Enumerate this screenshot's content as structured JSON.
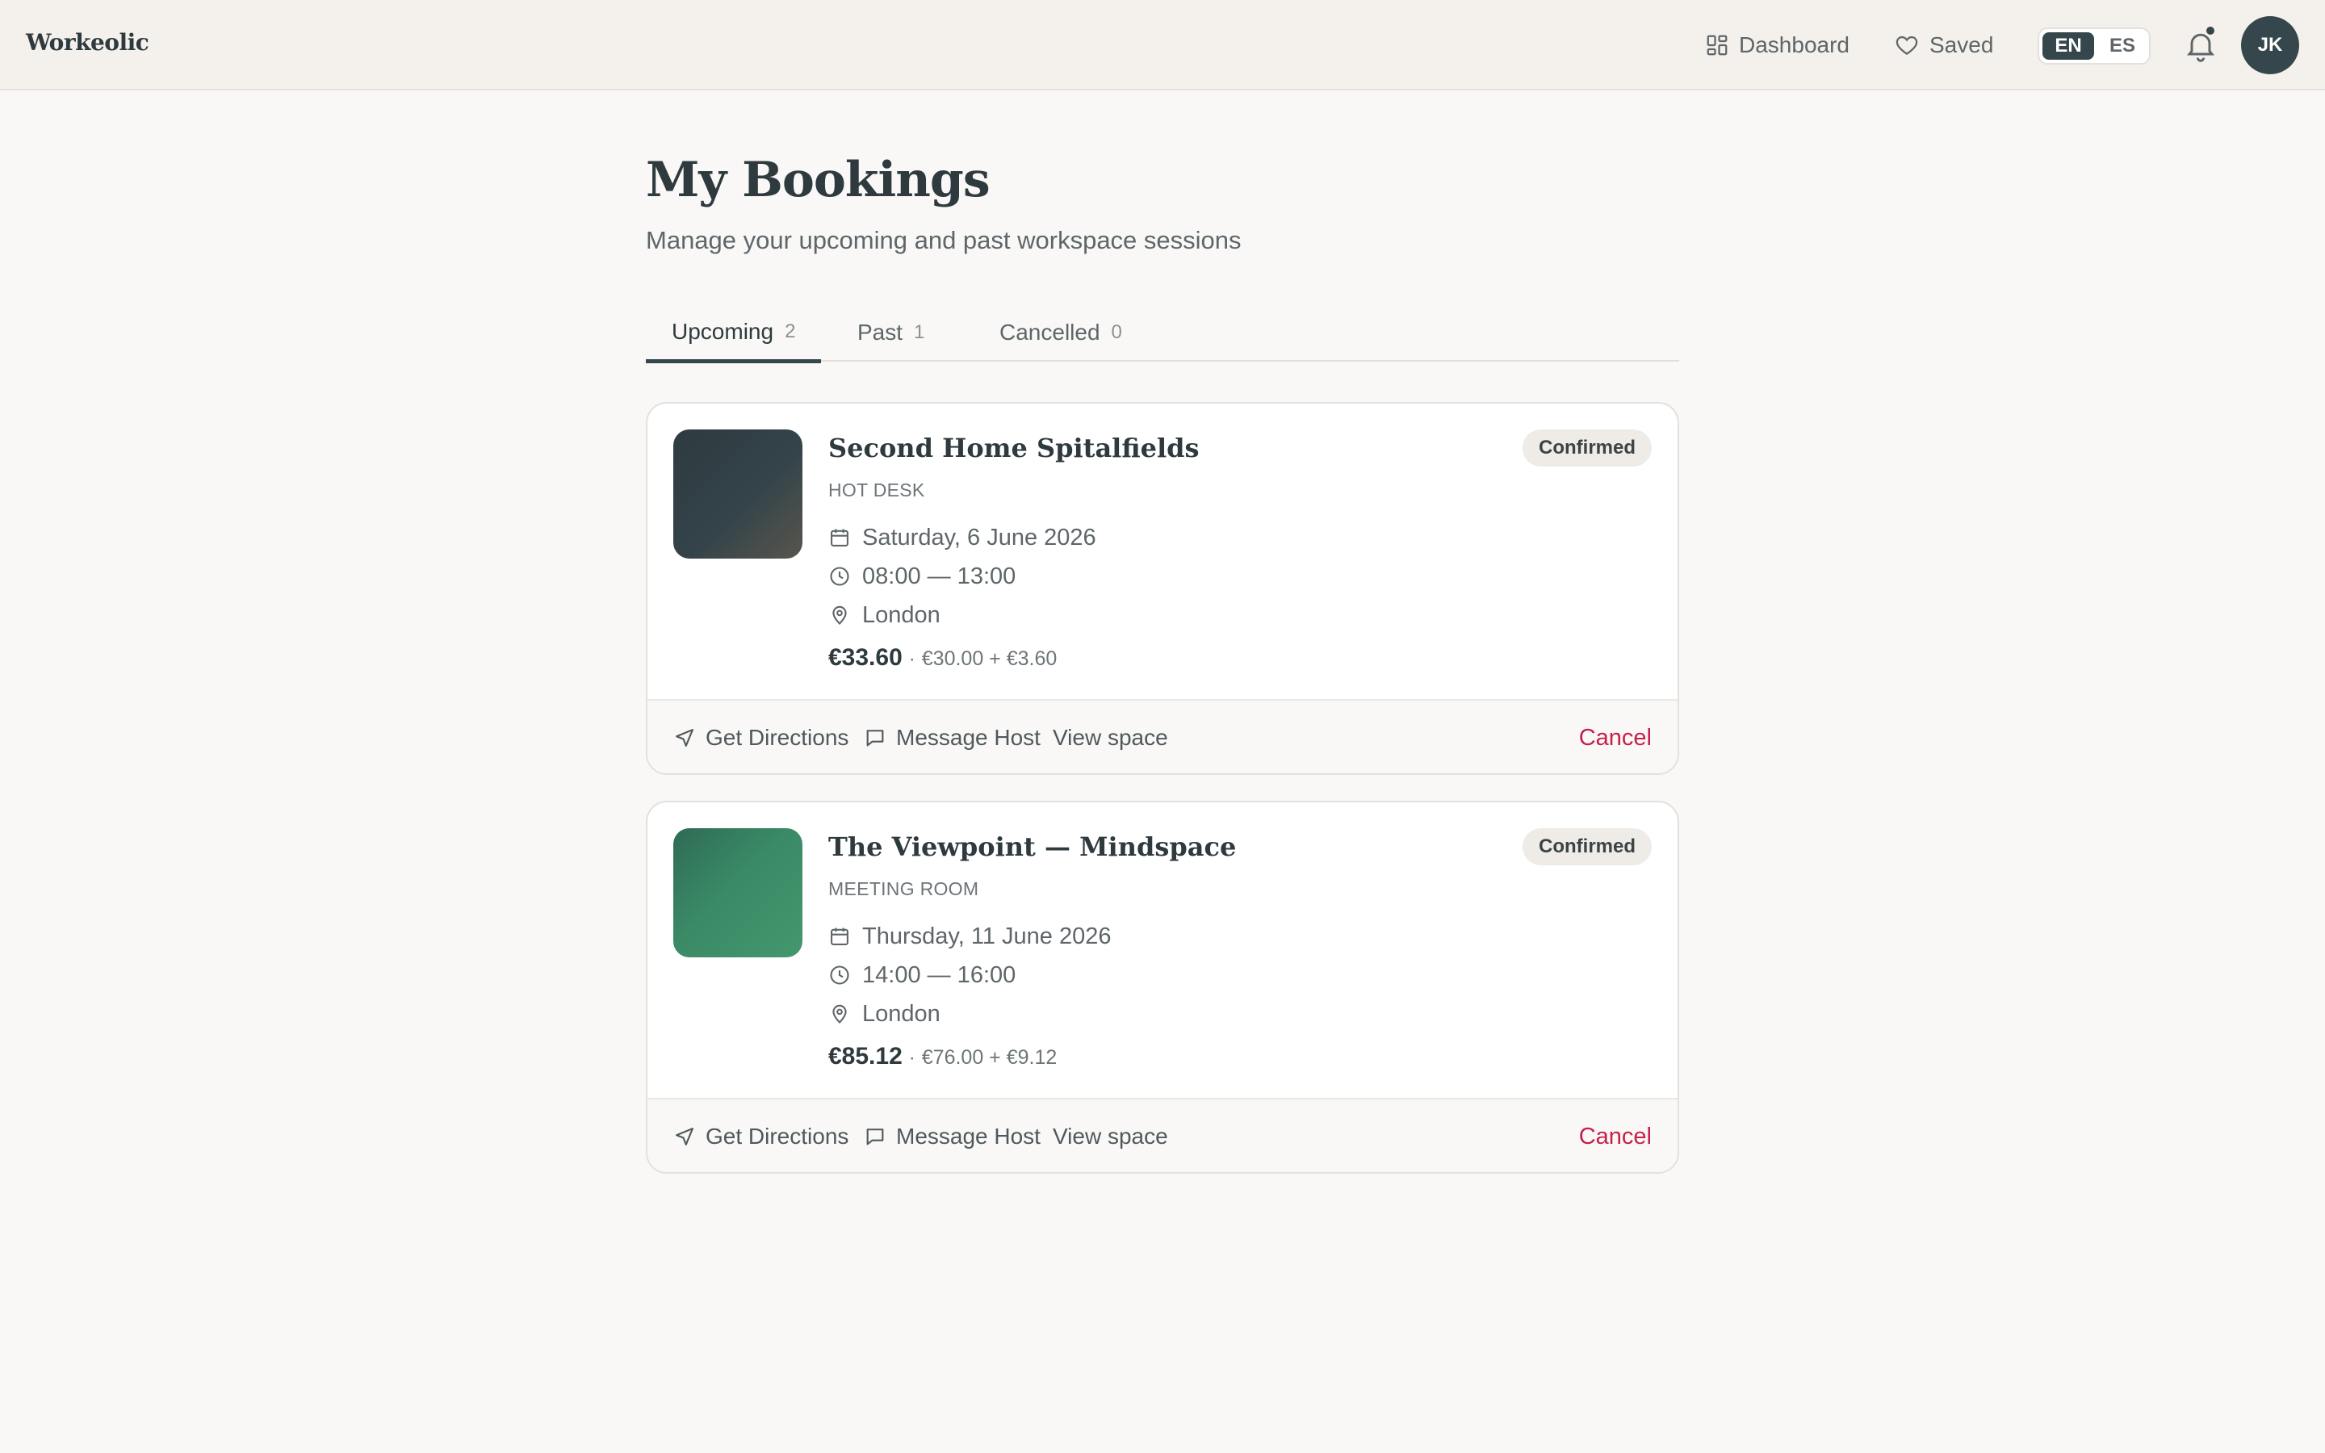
{
  "app": {
    "logo": "Workeolic"
  },
  "nav": {
    "dashboard_label": "Dashboard",
    "saved_label": "Saved",
    "lang_en": "EN",
    "lang_es": "ES",
    "avatar_initials": "JK"
  },
  "page": {
    "title": "My Bookings",
    "subtitle": "Manage your upcoming and past workspace sessions"
  },
  "tabs": [
    {
      "label": "Upcoming",
      "count": "2"
    },
    {
      "label": "Past",
      "count": "1"
    },
    {
      "label": "Cancelled",
      "count": "0"
    }
  ],
  "bookings": [
    {
      "name": "Second Home Spitalfields",
      "type": "HOT DESK",
      "status": "Confirmed",
      "date": "Saturday, 6 June 2026",
      "time": "08:00 — 13:00",
      "location": "London",
      "total": "€33.60",
      "separator": "·",
      "breakdown": "€30.00 + €3.60",
      "directions_label": "Get Directions",
      "message_label": "Message Host",
      "view_label": "View space",
      "cancel_label": "Cancel"
    },
    {
      "name": "The Viewpoint — Mindspace",
      "type": "MEETING ROOM",
      "status": "Confirmed",
      "date": "Thursday, 11 June 2026",
      "time": "14:00 — 16:00",
      "location": "London",
      "total": "€85.12",
      "separator": "·",
      "breakdown": "€76.00 + €9.12",
      "directions_label": "Get Directions",
      "message_label": "Message Host",
      "view_label": "View space",
      "cancel_label": "Cancel"
    }
  ],
  "colors": {
    "primary": "#35474c",
    "cancel": "#c81e4a",
    "header_bg": "#f4f0ec",
    "page_bg": "#f9f8f6"
  }
}
